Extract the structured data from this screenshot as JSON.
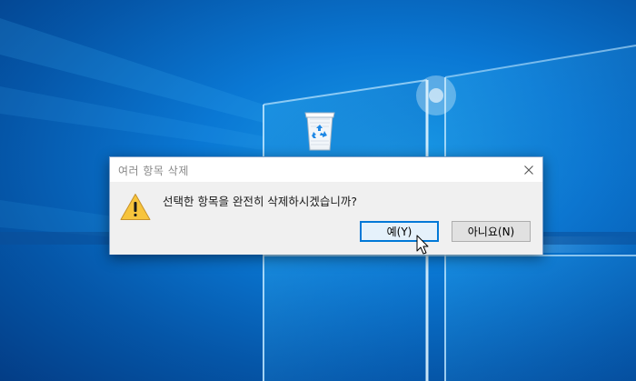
{
  "dialog": {
    "title": "여러 항목 삭제",
    "message": "선택한 항목을 완전히 삭제하시겠습니까?",
    "yes_label": "예(Y)",
    "no_label": "아니요(N)"
  },
  "icons": {
    "close": "close-icon",
    "warning": "warning-icon",
    "recycle_bin": "recycle-bin-icon",
    "cursor": "mouse-cursor"
  },
  "colors": {
    "desktop_blue": "#0a78d4",
    "focus_border": "#0078d7",
    "warning_yellow": "#f7c43c"
  }
}
